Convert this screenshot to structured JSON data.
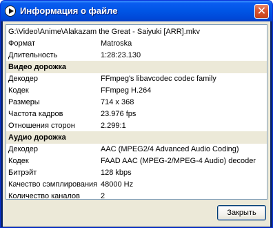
{
  "window": {
    "title": "Информация о файле",
    "close_symbol": "✕"
  },
  "info": {
    "path": "G:\\Video\\Anime\\Alakazam the Great - Saiyuki [ARR].mkv",
    "format_label": "Формат",
    "format_value": "Matroska",
    "duration_label": "Длительность",
    "duration_value": "1:28:23.130",
    "video_section": "Видео дорожка",
    "video_decoder_label": "Декодер",
    "video_decoder_value": "FFmpeg's libavcodec codec family",
    "video_codec_label": "Кодек",
    "video_codec_value": "FFmpeg H.264",
    "size_label": "Размеры",
    "size_value": "714 x 368",
    "fps_label": "Частота кадров",
    "fps_value": "23.976 fps",
    "aspect_label": "Отношения сторон",
    "aspect_value": "2.299:1",
    "audio_section": "Аудио дорожка",
    "audio_decoder_label": "Декодер",
    "audio_decoder_value": "AAC (MPEG2/4 Advanced Audio Coding)",
    "audio_codec_label": "Кодек",
    "audio_codec_value": "FAAD AAC (MPEG-2/MPEG-4 Audio) decoder",
    "bitrate_label": "Битрэйт",
    "bitrate_value": "128 kbps",
    "samplerate_label": "Качество сэмплирования",
    "samplerate_value": "48000 Hz",
    "channels_label": "Количество каналов",
    "channels_value": "2"
  },
  "buttons": {
    "close_label": "Закрыть"
  },
  "icons": {
    "title_icon": "play-icon"
  }
}
